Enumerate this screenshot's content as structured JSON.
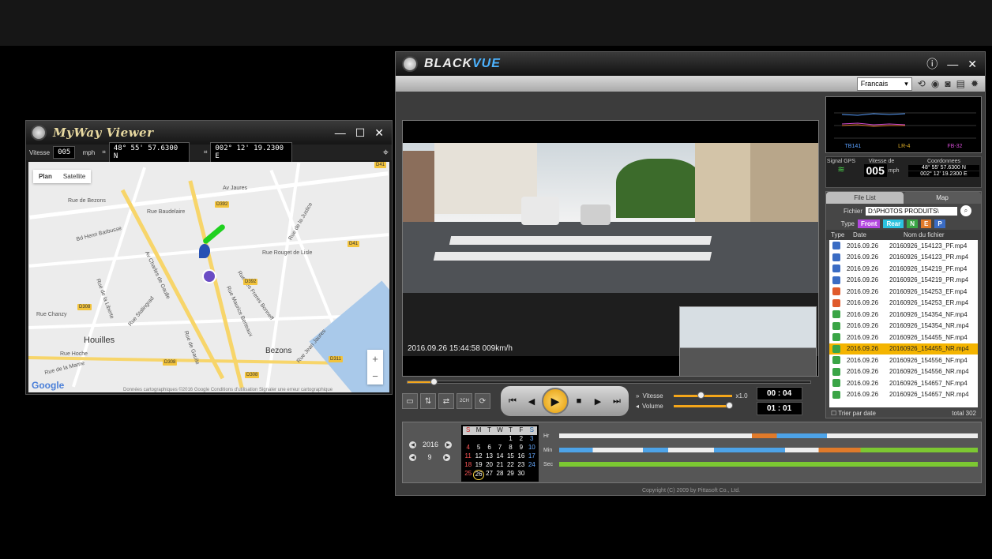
{
  "myway": {
    "title": "MyWay Viewer",
    "speed_label": "Vitesse",
    "speed": "005",
    "unit": "mph",
    "lat": "48°  55'  57.6300 N",
    "lon": "002°  12'  19.2300 E",
    "tabs": [
      "Plan",
      "Satellite"
    ],
    "labels": [
      "Av Jaures",
      "Rue Baudelaire",
      "Bd Henri Barbusse",
      "Rue Rouget de Lisle",
      "Rue de la Justice",
      "Rue Jean Jaures",
      "Rue Maurice Berteaux",
      "Rue des Freres Bonneff",
      "Houilles",
      "Bezons",
      "Rue de la Marne",
      "Av Charles de Gaulle",
      "Rue de la Liberte",
      "Rue Stalingrad",
      "Rue Hoche",
      "Rue Chanzy",
      "Rue de Bezons",
      "Rue de Gaulle"
    ],
    "shields": [
      "D392",
      "D392",
      "D41",
      "D41",
      "D308",
      "D308",
      "D308",
      "D311"
    ],
    "zoom_in": "+",
    "zoom_out": "−",
    "google": "Google",
    "footer": "Données cartographiques ©2016 Google   Conditions d'utilisation   Signaler une erreur cartographique"
  },
  "bv": {
    "brand_a": "BLACK",
    "brand_b": "VUE",
    "language": "Francais",
    "timestamp": "2016.09.26  15:44:58   009km/h",
    "graph_labels": [
      "TB141",
      "LR-4",
      "FB-32"
    ],
    "signal": "Signal GPS",
    "speed_label": "Vitesse de",
    "speed": "005",
    "unit": "mph",
    "coord_label": "Coordonnees",
    "lat": "48°  55' 57.6300 N",
    "lon": "002°  12' 19.2300 E",
    "tabs": [
      "File List",
      "Map"
    ],
    "file_label": "Fichier",
    "path": "D:\\PHOTOS PRODUITS\\",
    "type_label": "Type",
    "type_btns": [
      "Front",
      "Rear",
      "N",
      "E",
      "P"
    ],
    "cols": [
      "Type",
      "Date",
      "Nom du fichier"
    ],
    "files": [
      {
        "date": "2016.09.26",
        "name": "20160926_154123_PF.mp4",
        "color": "#3a6cc4"
      },
      {
        "date": "2016.09.26",
        "name": "20160926_154123_PR.mp4",
        "color": "#3a6cc4"
      },
      {
        "date": "2016.09.26",
        "name": "20160926_154219_PF.mp4",
        "color": "#3a6cc4"
      },
      {
        "date": "2016.09.26",
        "name": "20160926_154219_PR.mp4",
        "color": "#3a6cc4"
      },
      {
        "date": "2016.09.26",
        "name": "20160926_154253_EF.mp4",
        "color": "#e05a2b"
      },
      {
        "date": "2016.09.26",
        "name": "20160926_154253_ER.mp4",
        "color": "#e05a2b"
      },
      {
        "date": "2016.09.26",
        "name": "20160926_154354_NF.mp4",
        "color": "#3aa546"
      },
      {
        "date": "2016.09.26",
        "name": "20160926_154354_NR.mp4",
        "color": "#3aa546"
      },
      {
        "date": "2016.09.26",
        "name": "20160926_154455_NF.mp4",
        "color": "#3aa546"
      },
      {
        "date": "2016.09.26",
        "name": "20160926_154455_NR.mp4",
        "color": "#3aa546",
        "selected": true
      },
      {
        "date": "2016.09.26",
        "name": "20160926_154556_NF.mp4",
        "color": "#3aa546"
      },
      {
        "date": "2016.09.26",
        "name": "20160926_154556_NR.mp4",
        "color": "#3aa546"
      },
      {
        "date": "2016.09.26",
        "name": "20160926_154657_NF.mp4",
        "color": "#3aa546"
      },
      {
        "date": "2016.09.26",
        "name": "20160926_154657_NR.mp4",
        "color": "#3aa546"
      }
    ],
    "sort_label": "Trier par date",
    "total": "total 302",
    "vitesse": "Vitesse",
    "volume": "Volume",
    "rate": "x1.0",
    "time_a": "00 : 04",
    "time_b": "01 : 01",
    "ch_label": "2CH",
    "seek_fraction": 0.065,
    "speed_slider": 0.45,
    "volume_slider": 0.95,
    "year": "2016",
    "month": "9",
    "cal_head": [
      "S",
      "M",
      "T",
      "W",
      "T",
      "F",
      "S"
    ],
    "cal_days": [
      "",
      "",
      "",
      "",
      "1",
      "2",
      "3",
      "4",
      "5",
      "6",
      "7",
      "8",
      "9",
      "10",
      "11",
      "12",
      "13",
      "14",
      "15",
      "16",
      "17",
      "18",
      "19",
      "20",
      "21",
      "22",
      "23",
      "24",
      "25",
      "26",
      "27",
      "28",
      "29",
      "30",
      ""
    ],
    "hr_label": "Hr",
    "min_label": "Min",
    "sec_label": "Sec",
    "copyright": "Copyright (C) 2009 by Pittasoft Co., Ltd."
  }
}
